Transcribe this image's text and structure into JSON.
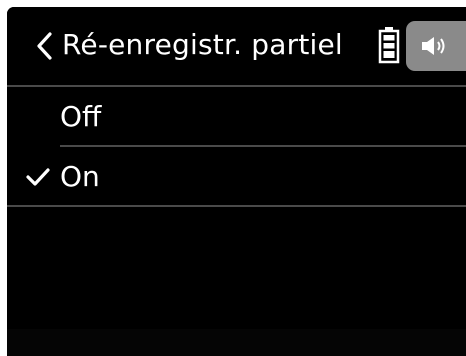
{
  "header": {
    "title": "Ré-enregistr. partiel",
    "back_icon": "chevron-left-icon",
    "battery_icon": "battery-icon",
    "speaker_icon": "speaker-icon"
  },
  "options": [
    {
      "label": "Off",
      "selected": false
    },
    {
      "label": "On",
      "selected": true
    }
  ],
  "colors": {
    "background": "#000000",
    "text": "#ffffff",
    "separator": "#4a4a4a",
    "speaker_tab": "#8a8a8a"
  }
}
